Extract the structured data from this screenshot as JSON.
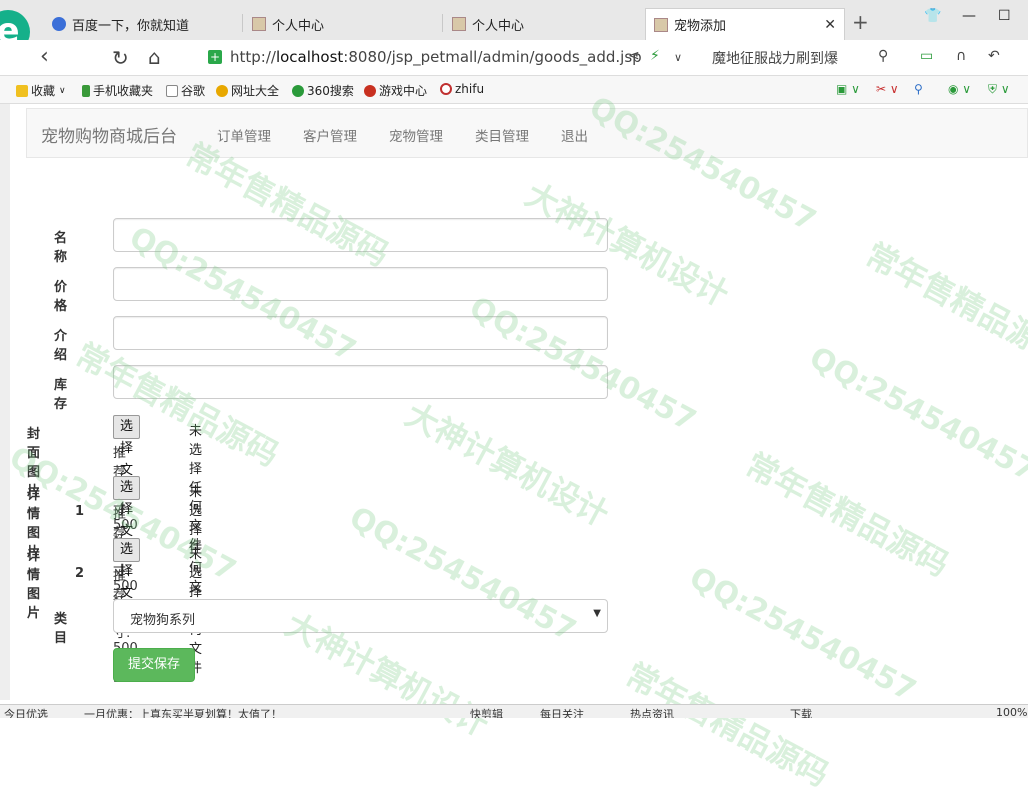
{
  "browser": {
    "tabs": [
      {
        "label": "百度一下，你就知道"
      },
      {
        "label": "个人中心"
      },
      {
        "label": "个人中心"
      },
      {
        "label": "宠物添加",
        "active": true
      }
    ],
    "url_host": "localhost",
    "url_prefix": "http://",
    "url_suffix": ":8080/jsp_petmall/admin/goods_add.jsp",
    "search_text": "魔地征服战力刷到爆",
    "bookmarks": [
      "收藏",
      "手机收藏夹",
      "谷歌",
      "网址大全",
      "360搜索",
      "游戏中心",
      "zhifu"
    ],
    "status_items": [
      "今日优选",
      "一月优惠：上真东买半夏划算！太值了！",
      "快剪辑",
      "每日关注",
      "热点资讯",
      "下载",
      "100%"
    ]
  },
  "app": {
    "brand": "宠物购物商城后台",
    "nav": [
      "订单管理",
      "客户管理",
      "宠物管理",
      "类目管理",
      "退出"
    ]
  },
  "form": {
    "name_label": "名称",
    "price_label": "价格",
    "intro_label": "介绍",
    "stock_label": "库存",
    "cover_label": "封面图片",
    "detail1_label_a": "详情图片",
    "detail1_label_b": "1",
    "detail2_label_a": "详情图片",
    "detail2_label_b": "2",
    "file_button": "选择文件",
    "file_none": "未选择任何文件",
    "size_hint": "推荐尺寸: 500 * 500",
    "category_label": "类目",
    "category_value": "宠物狗系列",
    "submit_label": "提交保存"
  },
  "watermark": {
    "qq": "QQ:254540457",
    "text1": "大神计算机设计",
    "text2": "常年售精品源码"
  }
}
